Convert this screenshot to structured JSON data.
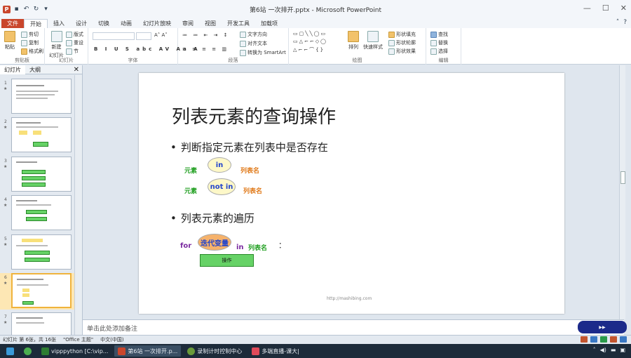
{
  "window": {
    "title": "第6站 一次排开.pptx - Microsoft PowerPoint"
  },
  "ribbon_tabs": [
    {
      "label": "文件"
    },
    {
      "label": "开始"
    },
    {
      "label": "插入"
    },
    {
      "label": "设计"
    },
    {
      "label": "切换"
    },
    {
      "label": "动画"
    },
    {
      "label": "幻灯片放映"
    },
    {
      "label": "审阅"
    },
    {
      "label": "视图"
    },
    {
      "label": "开发工具"
    },
    {
      "label": "加载项"
    }
  ],
  "ribbon": {
    "clipboard": {
      "paste": "粘贴",
      "cut": "剪切",
      "copy": "复制",
      "format_painter": "格式刷",
      "group_name": "剪贴板"
    },
    "slides": {
      "new_slide": "新建",
      "new_slide2": "幻灯片",
      "layout": "版式",
      "reset": "重设",
      "section": "节",
      "group_name": "幻灯片"
    },
    "font": {
      "group_name": "字体"
    },
    "paragraph": {
      "text_direction": "文字方向",
      "align_text": "对齐文本",
      "smartart": "转换为 SmartArt",
      "group_name": "段落"
    },
    "drawing": {
      "arrange": "排列",
      "quick_styles": "快速样式",
      "shape_fill": "形状填充",
      "shape_outline": "形状轮廓",
      "shape_effects": "形状效果",
      "group_name": "绘图"
    },
    "editing": {
      "find": "查找",
      "replace": "替换",
      "select": "选择",
      "group_name": "编辑"
    }
  },
  "left_pane": {
    "tab_slides": "幻灯片",
    "tab_outline": "大纲",
    "thumbnails": [
      {
        "num": "1"
      },
      {
        "num": "2"
      },
      {
        "num": "3"
      },
      {
        "num": "4"
      },
      {
        "num": "5"
      },
      {
        "num": "6"
      },
      {
        "num": "7"
      }
    ]
  },
  "slide": {
    "title": "列表元素的查询操作",
    "bullet1": "判断指定元素在列表中是否存在",
    "row1": {
      "left": "元素",
      "cloud": "in",
      "right": "列表名"
    },
    "row2": {
      "left": "元素",
      "cloud": "not in",
      "right": "列表名"
    },
    "bullet2": "列表元素的遍历",
    "row3": {
      "for": "for",
      "cloud": "迭代变量",
      "in": "in",
      "list": "列表名",
      "colon": "："
    },
    "op_box": "操作",
    "footer": "http://mashibing.com"
  },
  "notes": {
    "placeholder": "单击此处添加备注"
  },
  "status": {
    "slide_info": "幻灯片 第 6张，共 16张",
    "theme": "\"Office 主题\"",
    "language": "中文(中国)"
  },
  "taskbar": {
    "items": [
      {
        "label": "vipppython [C:\\vip..."
      },
      {
        "label": "第6站 一次排开.p..."
      },
      {
        "label": "录制计时控制中心"
      },
      {
        "label": "多端直播-课大|"
      }
    ]
  },
  "colors": {
    "accent": "#c9462c",
    "green": "#22a022",
    "orange": "#e07a1a",
    "purple": "#7a2aa0",
    "blue_text": "#2244cc"
  }
}
